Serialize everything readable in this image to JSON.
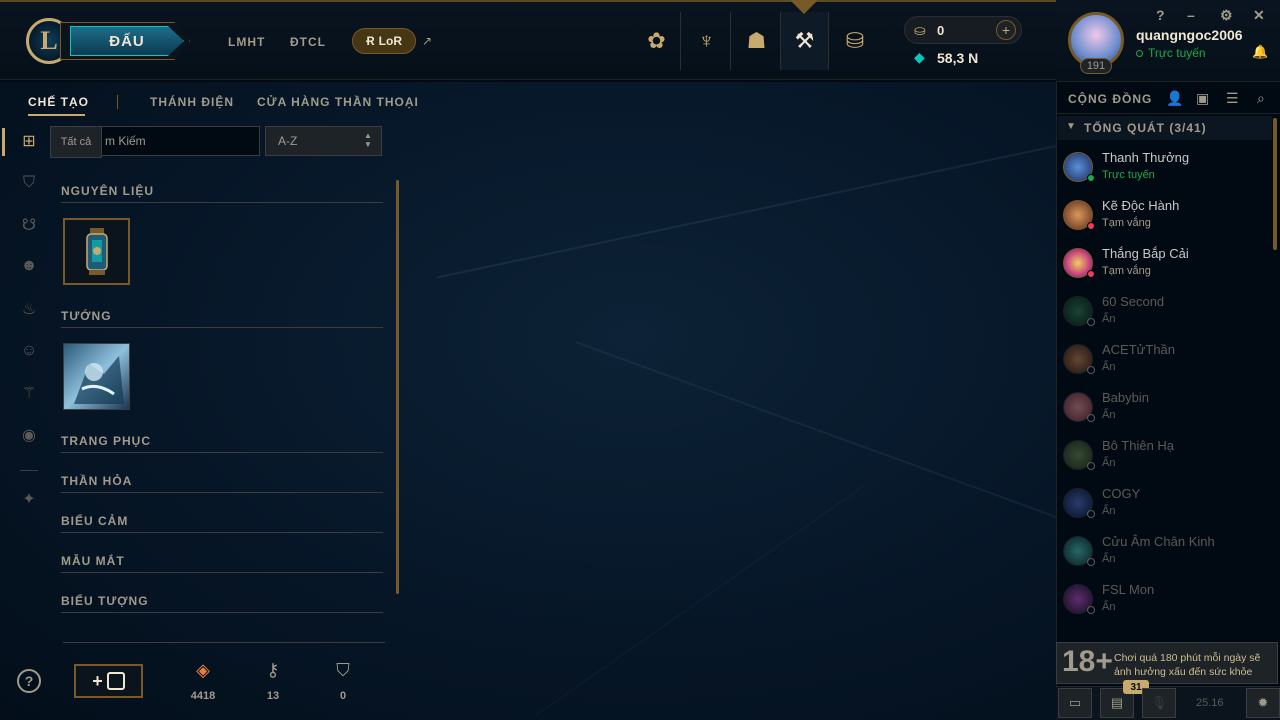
{
  "topnav": {
    "play_label": "ĐẤU",
    "links": [
      "LMHT",
      "ĐTCL"
    ],
    "lor_label": "LoR",
    "icons": [
      "home-icon",
      "tft-icon",
      "profile-icon",
      "loot-icon",
      "store-icon"
    ]
  },
  "currency": {
    "rp": "0",
    "be": "58,3 N"
  },
  "profile": {
    "username": "quangngoc2006",
    "status": "Trực tuyến",
    "level": "191"
  },
  "window_controls": [
    "?",
    "–",
    "⚙",
    "✕"
  ],
  "subtabs": [
    "CHẾ TẠO",
    "THÁNH ĐIỆN",
    "CỬA HÀNG THẦN THOẠI"
  ],
  "tooltip": "Tất cả",
  "search": {
    "placeholder": "Tìm Kiếm",
    "visible_text": "m Kiếm"
  },
  "sort": {
    "value": "A-Z"
  },
  "sections": [
    "NGUYÊN LIỆU",
    "TƯỚNG",
    "TRANG PHỤC",
    "THẦN HỎA",
    "BIỂU CẢM",
    "MẪU MẮT",
    "BIỂU TƯỢNG"
  ],
  "resources": {
    "essence": "4418",
    "keys": "13",
    "chests": "0"
  },
  "social": {
    "title": "CỘNG ĐỒNG",
    "group": "TỔNG QUÁT (3/41)",
    "friends": [
      {
        "name": "Thanh Thưởng",
        "status": "Trực tuyến"
      },
      {
        "name": "Kẽ Độc Hành",
        "status": "Tạm vắng"
      },
      {
        "name": "Thắng Bắp Cải",
        "status": "Tạm vắng"
      },
      {
        "name": "60 Second",
        "status": "Ẩn"
      },
      {
        "name": "ACETửThần",
        "status": "Ẩn"
      },
      {
        "name": "Babybin",
        "status": "Ẩn"
      },
      {
        "name": "Bô Thiên Hạ",
        "status": "Ẩn"
      },
      {
        "name": "COGY",
        "status": "Ẩn"
      },
      {
        "name": "Cửu Âm Chân Kinh",
        "status": "Ẩn"
      },
      {
        "name": "FSL Mon",
        "status": "Ẩn"
      }
    ]
  },
  "age_warning": {
    "badge": "18+",
    "text": "Chơi quá 180 phút mỗi ngày sẽ ảnh hưởng xấu đến sức khỏe"
  },
  "bottom": {
    "badge": "31",
    "version": "25.16"
  },
  "colors": {
    "gold": "#c8aa6e",
    "online": "#1ea94b",
    "away": "#e84057",
    "teal": "#0ac8b9"
  }
}
